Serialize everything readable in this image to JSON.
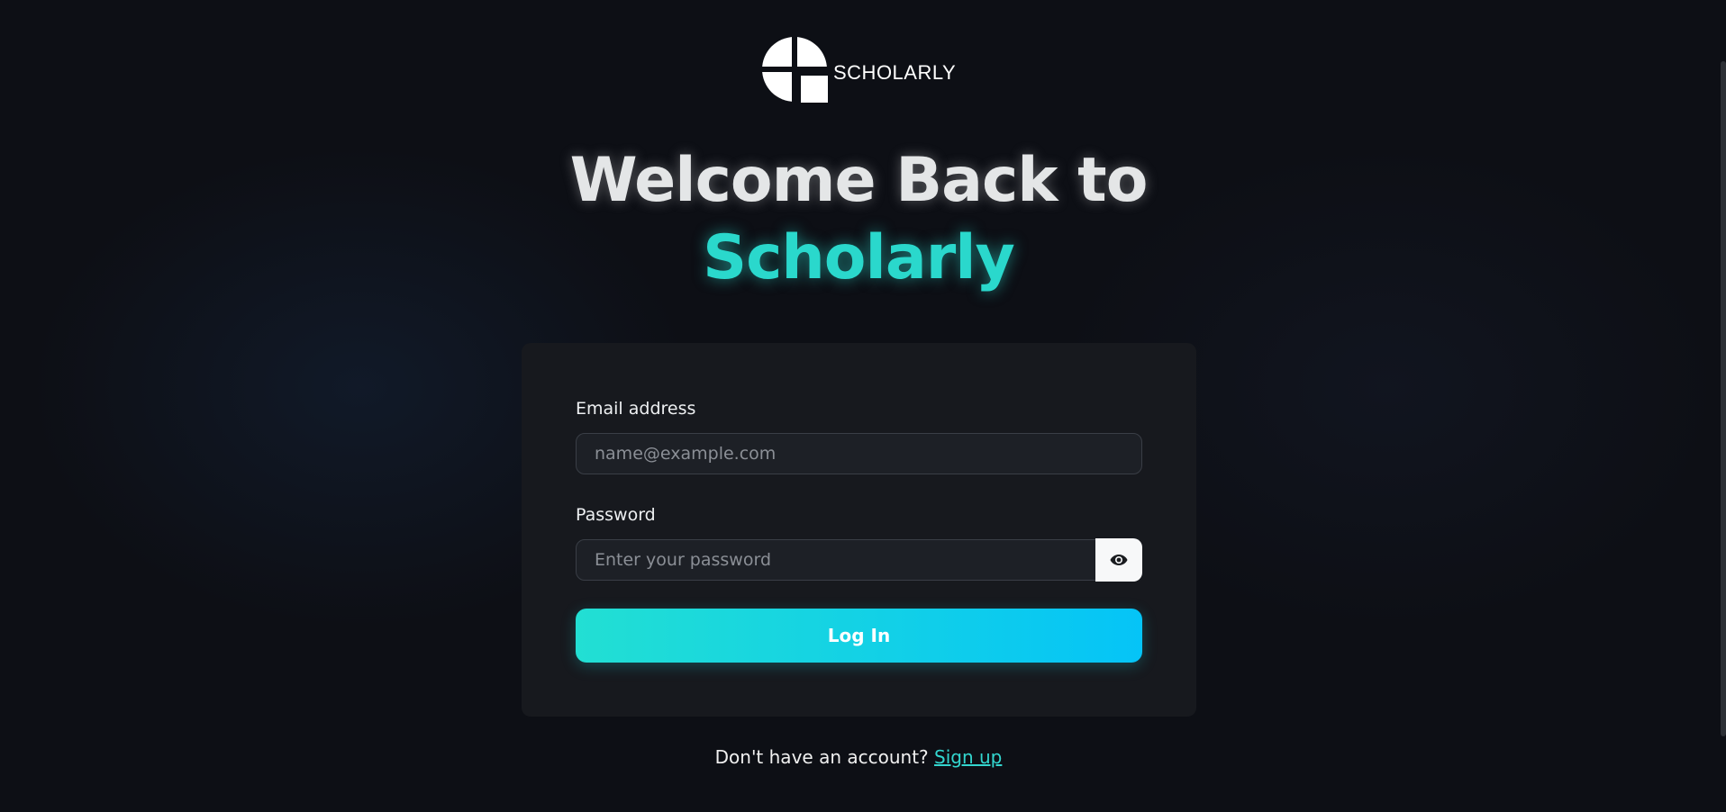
{
  "brand": {
    "name": "SCHOLARLY",
    "logo_icon": "scholarly-logo-icon"
  },
  "heading": {
    "line1": "Welcome Back to",
    "line2": "Scholarly"
  },
  "form": {
    "email_label": "Email address",
    "email_placeholder": "name@example.com",
    "email_value": "",
    "password_label": "Password",
    "password_placeholder": "Enter your password",
    "password_value": "",
    "show_password_icon": "eye-icon",
    "login_label": "Log In"
  },
  "footer": {
    "prompt": "Don't have an account?",
    "signup_label": "Sign up"
  },
  "colors": {
    "background": "#0d0f15",
    "card": "#17191e",
    "accent": "#2ad8cc",
    "button_gradient_start": "#22dfd3",
    "button_gradient_end": "#05c4f7"
  }
}
